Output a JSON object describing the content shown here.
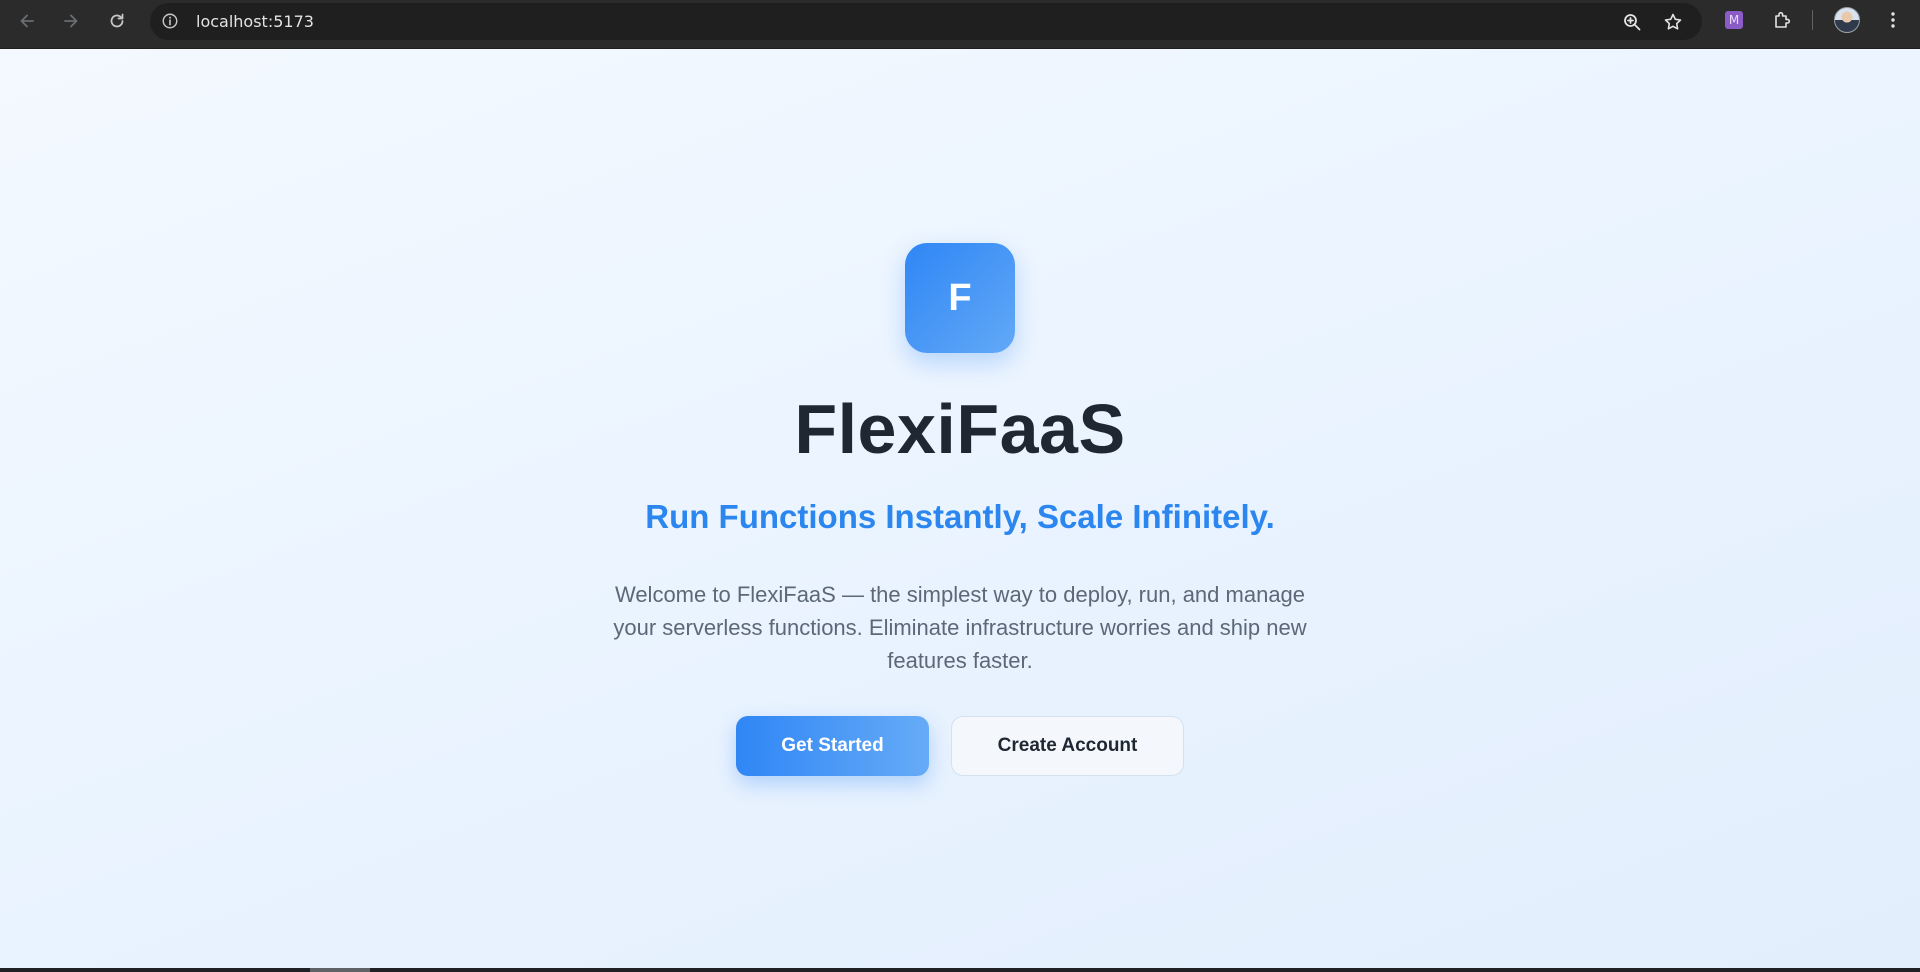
{
  "browser": {
    "url": "localhost:5173",
    "extension_badge": "M",
    "icons": [
      "back-icon",
      "forward-icon",
      "reload-icon",
      "site-info-icon",
      "zoom-icon",
      "bookmark-star-icon",
      "extension-m-icon",
      "extensions-puzzle-icon",
      "profile-avatar",
      "menu-kebab-icon"
    ]
  },
  "hero": {
    "logo_letter": "F",
    "title": "FlexiFaaS",
    "tagline": "Run Functions Instantly, Scale Infinitely.",
    "description": "Welcome to FlexiFaaS — the simplest way to deploy, run, and manage your serverless functions. Eliminate infrastructure worries and ship new features faster.",
    "primary_button": "Get Started",
    "secondary_button": "Create Account"
  },
  "colors": {
    "accent": "#2b86ef",
    "title": "#1f2733",
    "body_text": "#5d6877",
    "background": "#eef5fe"
  }
}
